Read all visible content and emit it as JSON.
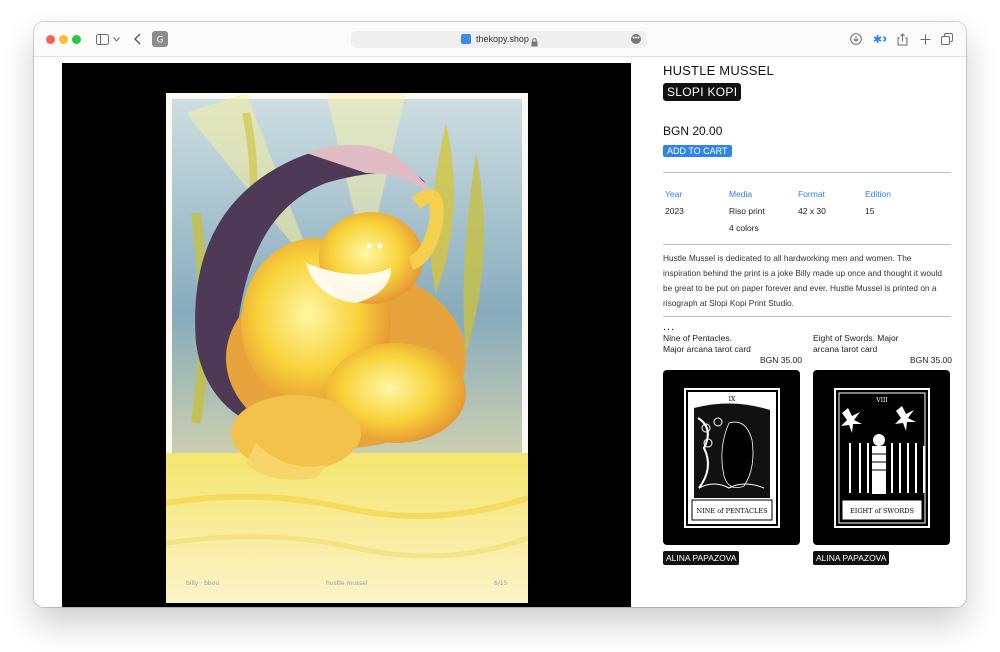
{
  "browser": {
    "url": "thekopy.shop",
    "icons": [
      "sidebar-icon",
      "chevron-down-icon",
      "back-icon",
      "tab-favicon",
      "download-icon",
      "extension-icon",
      "share-icon",
      "plus-icon",
      "tabs-icon"
    ]
  },
  "product": {
    "title": "HUSTLE MUSSEL",
    "brand": "SLOPI KOPI",
    "price": "BGN 20.00",
    "add_to_cart": "ADD TO CART",
    "specs": {
      "year_label": "Year",
      "year_value": "2023",
      "media_label": "Media",
      "media_value": "Riso print",
      "media_value_2": "4 colors",
      "format_label": "Format",
      "format_value": "42 x 30",
      "edition_label": "Edition",
      "edition_value": "15"
    },
    "description": "Hustle Mussel is dedicated to all hardworking men and women. The inspiration behind the print is a joke Billy made up once and thought it would be great to be put on paper forever and ever. Hustle Mussel is printed on a risograph at Slopi Kopi Print Studio.",
    "more": "..."
  },
  "related": [
    {
      "name": "Nine of Pentacles. Major arcana tarot card",
      "price": "BGN 35.00",
      "artist": "ALINA PAPAZOVA",
      "card_text": "NINE of PENTACLES",
      "card_numeral": "IX"
    },
    {
      "name": "Eight of Swords. Major arcana tarot card",
      "price": "BGN 35.00",
      "artist": "ALINA PAPAZOVA",
      "card_text": "EIGHT of SWORDS",
      "card_numeral": "VIII"
    }
  ],
  "colors": {
    "accent": "#2f84e8",
    "black": "#000000",
    "tag_bg": "#111111"
  }
}
